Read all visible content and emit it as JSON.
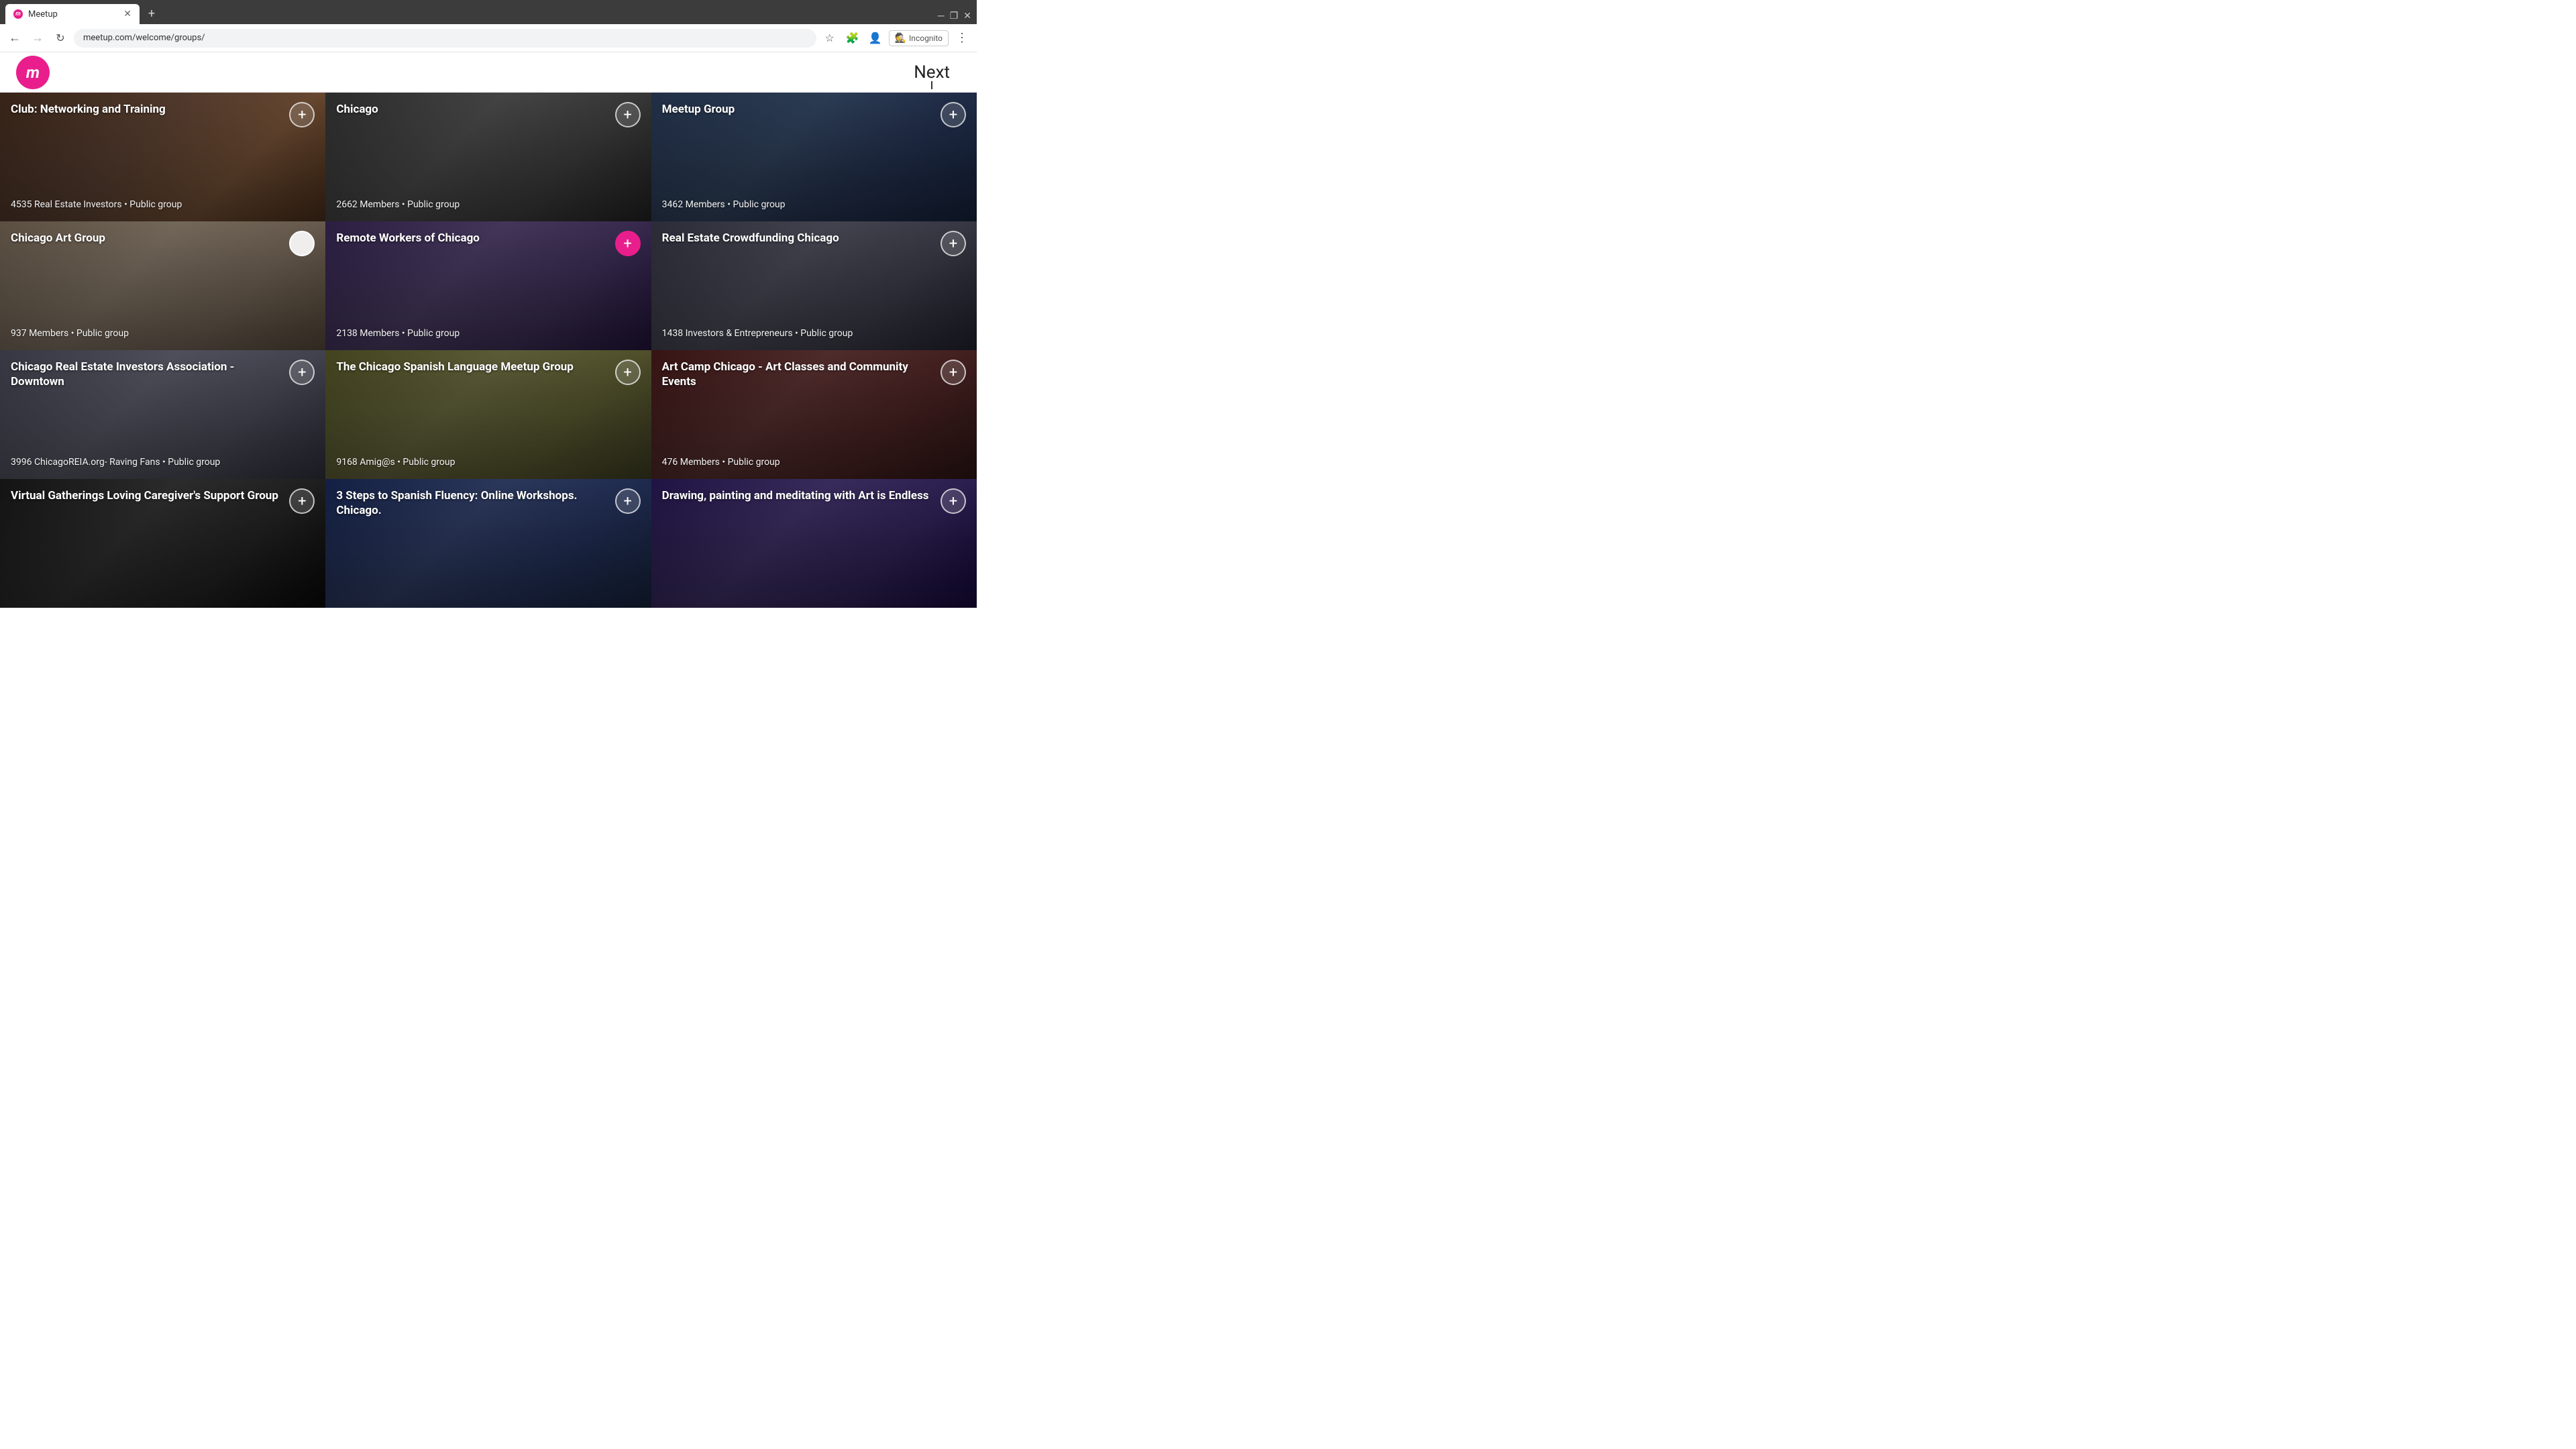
{
  "browser": {
    "tab_title": "Meetup",
    "url": "meetup.com/welcome/groups/",
    "incognito_label": "Incognito",
    "new_tab_symbol": "+"
  },
  "header": {
    "logo_letter": "m",
    "next_label": "Next"
  },
  "groups": [
    {
      "id": "group-1",
      "title": "Club: Networking and Training",
      "members": "4535 Real Estate Investors • Public group",
      "bg_class": "bg-brown",
      "badge_type": "inactive",
      "row": 0
    },
    {
      "id": "group-2",
      "title": "Chicago",
      "members": "2662 Members • Public group",
      "bg_class": "bg-darkgray",
      "badge_type": "inactive",
      "row": 0
    },
    {
      "id": "group-3",
      "title": "Meetup Group",
      "members": "3462 Members • Public group",
      "bg_class": "bg-navy",
      "badge_type": "inactive",
      "row": 0
    },
    {
      "id": "group-4",
      "title": "Chicago Art Group",
      "members": "937 Members • Public group",
      "bg_class": "bg-taupe",
      "badge_type": "active",
      "row": 1
    },
    {
      "id": "group-5",
      "title": "Remote Workers of Chicago",
      "members": "2138 Members • Public group",
      "bg_class": "bg-purple",
      "badge_type": "joined",
      "row": 1
    },
    {
      "id": "group-6",
      "title": "Real Estate Crowdfunding Chicago",
      "members": "1438 Investors & Entrepreneurs • Public group",
      "bg_class": "bg-darkgray",
      "badge_type": "inactive",
      "row": 1
    },
    {
      "id": "group-7",
      "title": "Chicago Real Estate Investors Association - Downtown",
      "members": "3996 ChicagoREIA.org- Raving Fans • Public group",
      "bg_class": "bg-gray",
      "badge_type": "inactive",
      "row": 2
    },
    {
      "id": "group-8",
      "title": "The Chicago Spanish Language Meetup Group",
      "members": "9168 Amig@s • Public group",
      "bg_class": "bg-olive",
      "badge_type": "inactive",
      "row": 2
    },
    {
      "id": "group-9",
      "title": "Art Camp Chicago - Art Classes and Community Events",
      "members": "476 Members • Public group",
      "bg_class": "bg-darkred",
      "badge_type": "inactive",
      "row": 2
    },
    {
      "id": "group-10",
      "title": "Virtual Gatherings Loving Caregiver's Support Group",
      "members": "",
      "bg_class": "bg-black",
      "badge_type": "inactive",
      "row": 3
    },
    {
      "id": "group-11",
      "title": "3 Steps to Spanish Fluency: Online Workshops. Chicago.",
      "members": "",
      "bg_class": "bg-blue",
      "badge_type": "inactive",
      "row": 3
    },
    {
      "id": "group-12",
      "title": "Drawing, painting and meditating with Art is Endless",
      "members": "",
      "bg_class": "bg-violet",
      "badge_type": "inactive",
      "row": 3
    }
  ]
}
